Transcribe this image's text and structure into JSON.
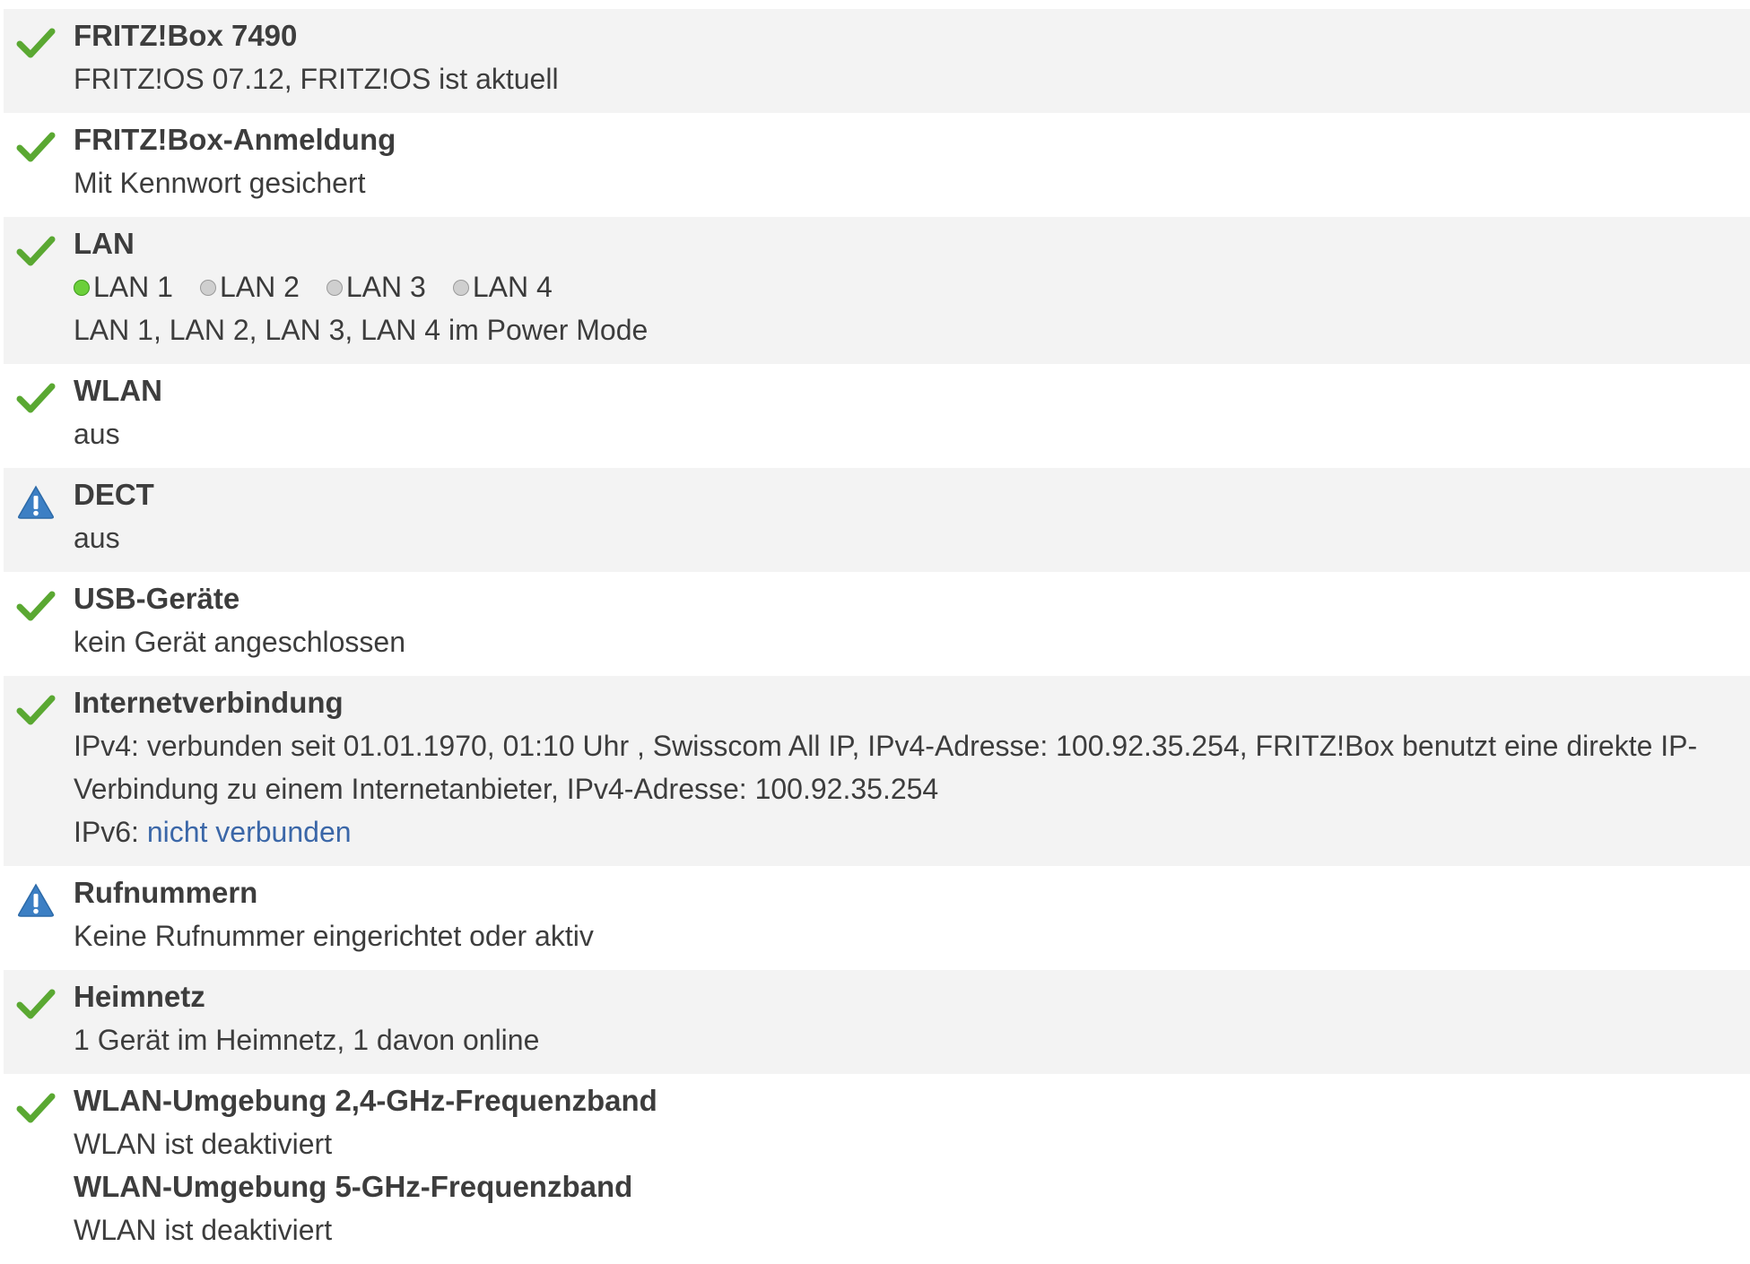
{
  "colors": {
    "ok": "#5aa832",
    "warning": "#3c7fc4",
    "link": "#3b67a8",
    "port_on": "#6bcf3a",
    "port_off": "#cfcfcf"
  },
  "rows": [
    {
      "icon": "check-icon",
      "title": "FRITZ!Box 7490",
      "lines": [
        "FRITZ!OS 07.12, FRITZ!OS ist aktuell"
      ]
    },
    {
      "icon": "check-icon",
      "title": "FRITZ!Box-Anmeldung",
      "lines": [
        "Mit Kennwort gesichert"
      ]
    },
    {
      "icon": "check-icon",
      "title": "LAN",
      "ports": [
        {
          "label": "LAN 1",
          "status": "on"
        },
        {
          "label": "LAN 2",
          "status": "off"
        },
        {
          "label": "LAN 3",
          "status": "off"
        },
        {
          "label": "LAN 4",
          "status": "off"
        }
      ],
      "lines": [
        "LAN 1, LAN 2, LAN 3, LAN 4 im Power Mode"
      ]
    },
    {
      "icon": "check-icon",
      "title": "WLAN",
      "lines": [
        "aus"
      ]
    },
    {
      "icon": "warning-icon",
      "title": "DECT",
      "lines": [
        "aus"
      ]
    },
    {
      "icon": "check-icon",
      "title": "USB-Geräte",
      "lines": [
        "kein Gerät angeschlossen"
      ]
    },
    {
      "icon": "check-icon",
      "title": "Internetverbindung",
      "lines": [
        "IPv4: verbunden seit 01.01.1970, 01:10 Uhr , Swisscom All IP, IPv4-Adresse: 100.92.35.254, FRITZ!Box benutzt eine direkte IP-Verbindung zu einem Internetanbieter, IPv4-Adresse: 100.92.35.254"
      ],
      "ipv6_label": "IPv6:",
      "ipv6_link": "nicht verbunden"
    },
    {
      "icon": "warning-icon",
      "title": "Rufnummern",
      "lines": [
        "Keine Rufnummer eingerichtet oder aktiv"
      ]
    },
    {
      "icon": "check-icon",
      "title": "Heimnetz",
      "lines": [
        "1 Gerät im Heimnetz, 1 davon online"
      ]
    },
    {
      "icon": "check-icon",
      "title": "WLAN-Umgebung 2,4-GHz-Frequenzband",
      "lines": [
        "WLAN ist deaktiviert"
      ],
      "title2": "WLAN-Umgebung 5-GHz-Frequenzband",
      "lines2": [
        "WLAN ist deaktiviert"
      ]
    }
  ]
}
